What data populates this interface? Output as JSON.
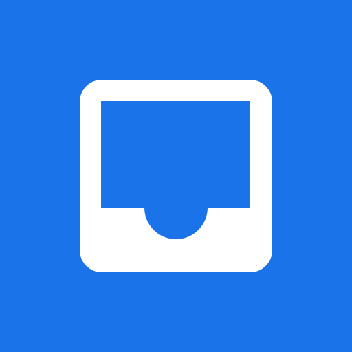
{
  "app_icon": {
    "icon": "inbox-tray-icon",
    "colors": {
      "background": "#1A73E8",
      "glyph": "#FFFFFF"
    }
  }
}
